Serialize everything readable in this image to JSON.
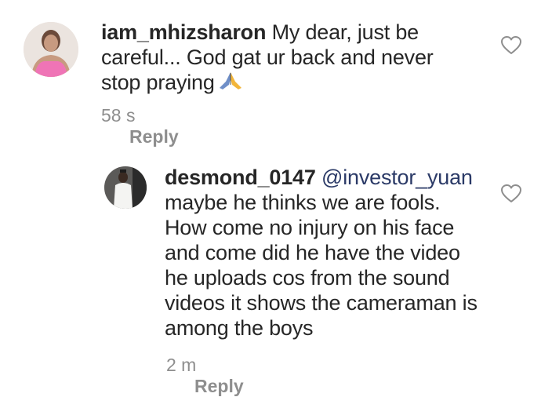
{
  "comments": [
    {
      "username": "iam_mhizsharon",
      "text": "My dear,  just be careful... God gat ur back and never stop praying",
      "emoji_icon": "praying-hands-icon",
      "time": "58 s",
      "reply_label": "Reply"
    },
    {
      "username": "desmond_0147",
      "mention": "@investor_yuan",
      "text": "maybe he thinks we are fools. How come no injury on his face and come did he have the video he uploads cos from the sound videos it shows the cameraman is among the boys",
      "time": "2 m",
      "reply_label": "Reply"
    }
  ],
  "icons": {
    "like": "heart-outline-icon"
  },
  "colors": {
    "text": "#262626",
    "muted": "#8e8e8e",
    "mention": "#2b3a67"
  }
}
